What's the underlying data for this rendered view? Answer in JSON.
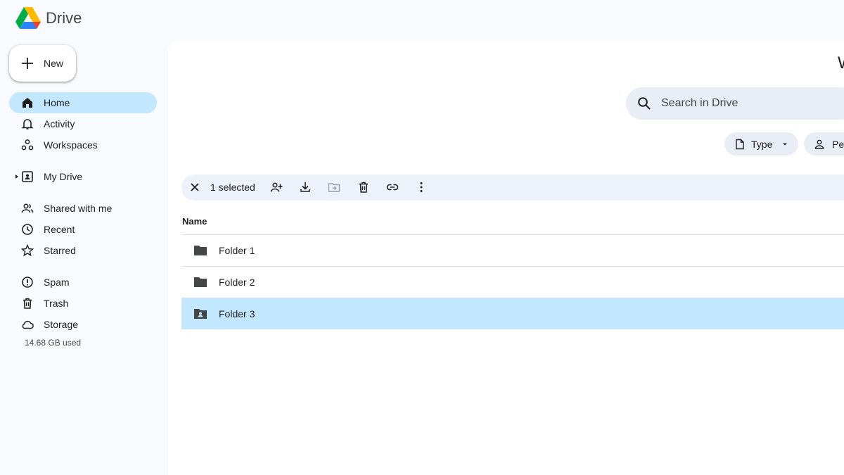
{
  "app": {
    "name": "Drive",
    "welcome_partial": "W"
  },
  "new_button": {
    "label": "New"
  },
  "sidebar": {
    "items": [
      {
        "label": "Home",
        "icon": "home-icon",
        "active": true
      },
      {
        "label": "Activity",
        "icon": "bell-icon"
      },
      {
        "label": "Workspaces",
        "icon": "workspaces-icon"
      },
      {
        "label": "My Drive",
        "icon": "my-drive-icon"
      },
      {
        "label": "Shared with me",
        "icon": "people-icon"
      },
      {
        "label": "Recent",
        "icon": "clock-icon"
      },
      {
        "label": "Starred",
        "icon": "star-icon"
      },
      {
        "label": "Spam",
        "icon": "spam-icon"
      },
      {
        "label": "Trash",
        "icon": "trash-icon"
      },
      {
        "label": "Storage",
        "icon": "cloud-icon"
      }
    ],
    "storage_used": "14.68 GB used"
  },
  "search": {
    "placeholder": "Search in Drive"
  },
  "filters": {
    "type_label": "Type",
    "people_label": "Peo"
  },
  "toolbar": {
    "selected_label": "1 selected"
  },
  "table": {
    "column_name": "Name",
    "rows": [
      {
        "name": "Folder 1",
        "selected": false,
        "shared": false
      },
      {
        "name": "Folder 2",
        "selected": false,
        "shared": false
      },
      {
        "name": "Folder 3",
        "selected": true,
        "shared": true
      }
    ]
  },
  "colors": {
    "accent": "#c2e7ff",
    "surface": "#f8fafd",
    "toolbar": "#edf2fa",
    "search": "#e9eef6"
  }
}
